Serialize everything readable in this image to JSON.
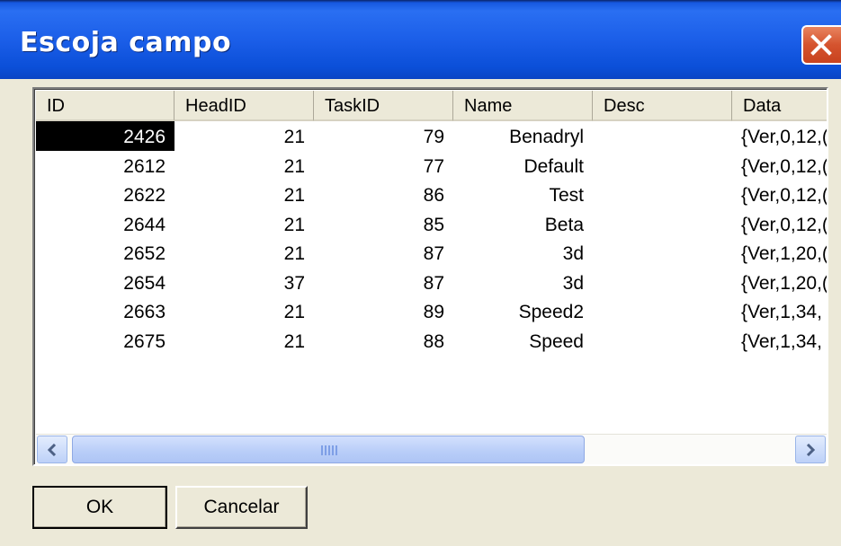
{
  "window": {
    "title": "Escoja campo"
  },
  "columns": [
    "ID",
    "HeadID",
    "TaskID",
    "Name",
    "Desc",
    "Data"
  ],
  "rows": [
    [
      "2426",
      "21",
      "79",
      "Benadryl",
      "",
      "{Ver,0,12,("
    ],
    [
      "2612",
      "21",
      "77",
      "Default",
      "",
      "{Ver,0,12,("
    ],
    [
      "2622",
      "21",
      "86",
      "Test",
      "",
      "{Ver,0,12,("
    ],
    [
      "2644",
      "21",
      "85",
      "Beta",
      "",
      "{Ver,0,12,("
    ],
    [
      "2652",
      "21",
      "87",
      "3d",
      "",
      "{Ver,1,20,("
    ],
    [
      "2654",
      "37",
      "87",
      "3d",
      "",
      "{Ver,1,20,("
    ],
    [
      "2663",
      "21",
      "89",
      "Speed2",
      "",
      " {Ver,1,34,"
    ],
    [
      "2675",
      "21",
      "88",
      "Speed",
      "",
      " {Ver,1,34,"
    ]
  ],
  "selected_row": 0,
  "buttons": {
    "ok": "OK",
    "cancel": "Cancelar"
  },
  "scrollbar": {
    "position": 0.0,
    "visible_fraction": 0.68
  },
  "icons": {
    "close": "close-icon",
    "left": "arrow-left-icon",
    "right": "arrow-right-icon"
  },
  "colors": {
    "titlebar": "#0b4fd8",
    "close": "#d5532e",
    "selection": "#000000",
    "dialog_bg": "#ece9d8"
  }
}
